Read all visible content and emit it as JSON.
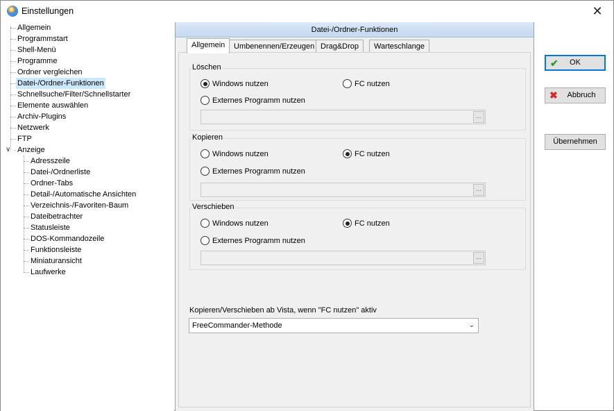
{
  "window": {
    "title": "Einstellungen",
    "close_glyph": "✕",
    "app_icon": "freecommander-icon"
  },
  "tree": {
    "items": [
      {
        "label": "Allgemein"
      },
      {
        "label": "Programmstart"
      },
      {
        "label": "Shell-Menü"
      },
      {
        "label": "Programme"
      },
      {
        "label": "Ordner vergleichen"
      },
      {
        "label": "Datei-/Ordner-Funktionen",
        "selected": true
      },
      {
        "label": "Schnellsuche/Filter/Schnellstarter"
      },
      {
        "label": "Elemente auswählen"
      },
      {
        "label": "Archiv-Plugins"
      },
      {
        "label": "Netzwerk"
      },
      {
        "label": "FTP"
      },
      {
        "label": "Anzeige",
        "expanded": true
      }
    ],
    "children": [
      {
        "label": "Adresszeile"
      },
      {
        "label": "Datei-/Ordnerliste"
      },
      {
        "label": "Ordner-Tabs"
      },
      {
        "label": "Detail-/Automatische Ansichten"
      },
      {
        "label": "Verzeichnis-/Favoriten-Baum"
      },
      {
        "label": "Dateibetrachter"
      },
      {
        "label": "Statusleiste"
      },
      {
        "label": "DOS-Kommandozeile"
      },
      {
        "label": "Funktionsleiste"
      },
      {
        "label": "Miniaturansicht"
      },
      {
        "label": "Laufwerke"
      }
    ]
  },
  "panel": {
    "header": "Datei-/Ordner-Funktionen",
    "tabs": [
      {
        "label": "Allgemein",
        "active": true
      },
      {
        "label": "Umbenennen/Erzeugen"
      },
      {
        "label": "Drag&Drop"
      },
      {
        "label": "Warteschlange"
      }
    ],
    "groups": [
      {
        "label": "Löschen",
        "opt_windows": "Windows nutzen",
        "opt_fc": "FC nutzen",
        "opt_external": "Externes Programm nutzen",
        "selected": "windows",
        "path_value": "",
        "browse": "..."
      },
      {
        "label": "Kopieren",
        "opt_windows": "Windows nutzen",
        "opt_fc": "FC nutzen",
        "opt_external": "Externes Programm nutzen",
        "selected": "fc",
        "path_value": "",
        "browse": "..."
      },
      {
        "label": "Verschieben",
        "opt_windows": "Windows nutzen",
        "opt_fc": "FC nutzen",
        "opt_external": "Externes Programm nutzen",
        "selected": "fc",
        "path_value": "",
        "browse": "..."
      }
    ],
    "vista_label": "Kopieren/Verschieben ab Vista, wenn \"FC nutzen\" aktiv",
    "vista_select": {
      "value": "FreeCommander-Methode"
    }
  },
  "buttons": {
    "ok": "OK",
    "cancel": "Abbruch",
    "apply": "Übernehmen"
  },
  "colors": {
    "accent": "#0078d7",
    "selection": "#cce8ff",
    "ok_check": "#2e9a2e",
    "cancel_x": "#d62b2b"
  }
}
